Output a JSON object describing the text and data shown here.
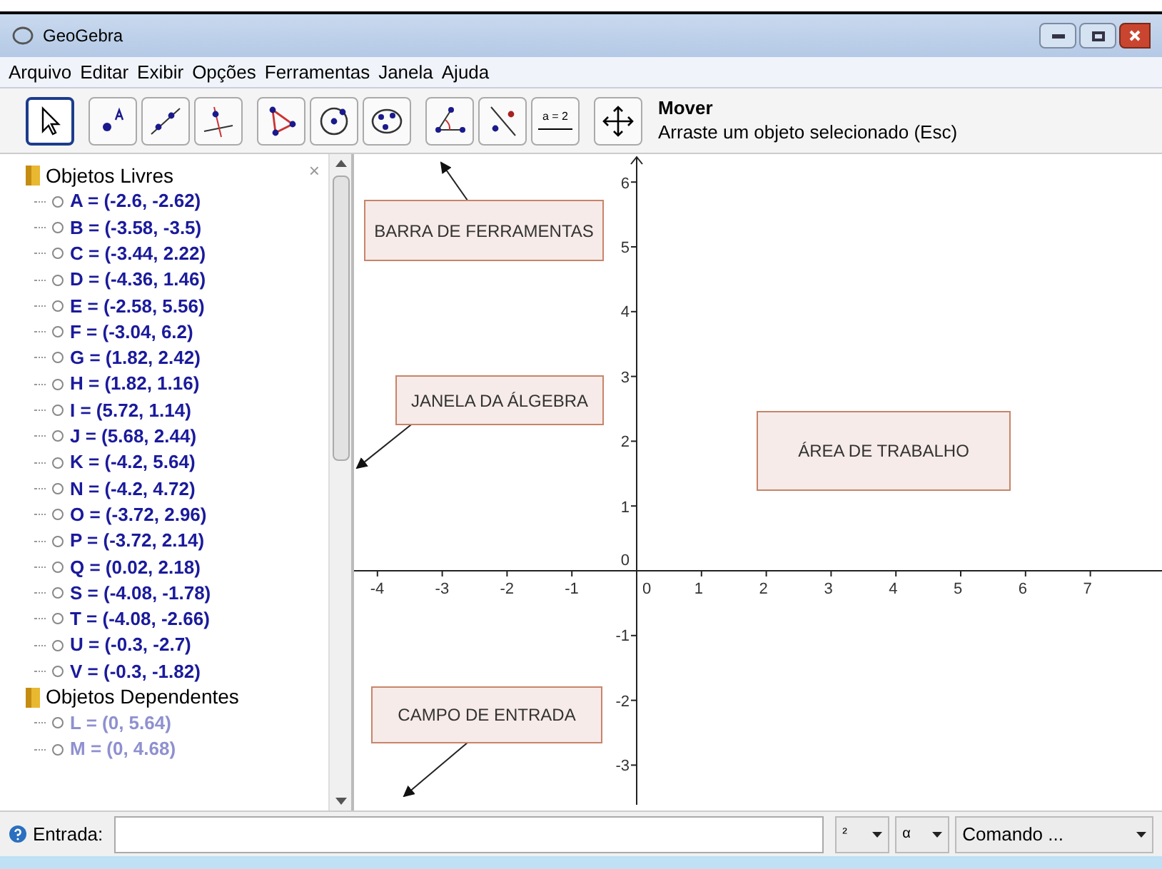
{
  "window": {
    "title": "GeoGebra"
  },
  "menu": [
    "Arquivo",
    "Editar",
    "Exibir",
    "Opções",
    "Ferramentas",
    "Janela",
    "Ajuda"
  ],
  "toolbar": {
    "tools": [
      {
        "kind": "move",
        "selected": true
      },
      {
        "kind": "point",
        "selected": false
      },
      {
        "kind": "line",
        "selected": false
      },
      {
        "kind": "perpendicular",
        "selected": false
      },
      {
        "kind": "polygon",
        "selected": false
      },
      {
        "kind": "circle",
        "selected": false
      },
      {
        "kind": "ellipse",
        "selected": false
      },
      {
        "kind": "angle",
        "selected": false
      },
      {
        "kind": "reflect",
        "selected": false
      },
      {
        "kind": "slider",
        "selected": false,
        "label": "a = 2"
      },
      {
        "kind": "pan",
        "selected": false
      }
    ],
    "tool_name": "Mover",
    "tool_help": "Arraste um objeto selecionado (Esc)"
  },
  "algebra": {
    "groups": [
      {
        "title": "Objetos Livres",
        "dependent": false,
        "items": [
          "A = (-2.6, -2.62)",
          "B = (-3.58, -3.5)",
          "C = (-3.44, 2.22)",
          "D = (-4.36, 1.46)",
          "E = (-2.58, 5.56)",
          "F = (-3.04, 6.2)",
          "G = (1.82, 2.42)",
          "H = (1.82, 1.16)",
          "I = (5.72, 1.14)",
          "J = (5.68, 2.44)",
          "K = (-4.2, 5.64)",
          "N = (-4.2, 4.72)",
          "O = (-3.72, 2.96)",
          "P = (-3.72, 2.14)",
          "Q = (0.02, 2.18)",
          "S = (-4.08, -1.78)",
          "T = (-4.08, -2.66)",
          "U = (-0.3, -2.7)",
          "V = (-0.3, -1.82)"
        ]
      },
      {
        "title": "Objetos Dependentes",
        "dependent": true,
        "items": [
          "L = (0, 5.64)",
          "M = (0, 4.68)"
        ]
      }
    ],
    "close": "×"
  },
  "graphics": {
    "x_labels": [
      "-4",
      "-3",
      "-2",
      "-1",
      "0",
      "1",
      "2",
      "3",
      "4",
      "5",
      "6",
      "7"
    ],
    "y_labels": [
      "6",
      "5",
      "4",
      "3",
      "2",
      "1",
      "0",
      "-1",
      "-2",
      "-3"
    ],
    "notes": [
      {
        "text": "BARRA DE FERRAMENTAS",
        "arrow": true
      },
      {
        "text": "JANELA DA ÁLGEBRA",
        "arrow": true
      },
      {
        "text": "ÁREA DE TRABALHO",
        "arrow": false
      },
      {
        "text": "CAMPO DE ENTRADA",
        "arrow": true
      }
    ]
  },
  "input": {
    "label": "Entrada:",
    "superscript": "²",
    "greek": "α",
    "command": "Comando ..."
  }
}
